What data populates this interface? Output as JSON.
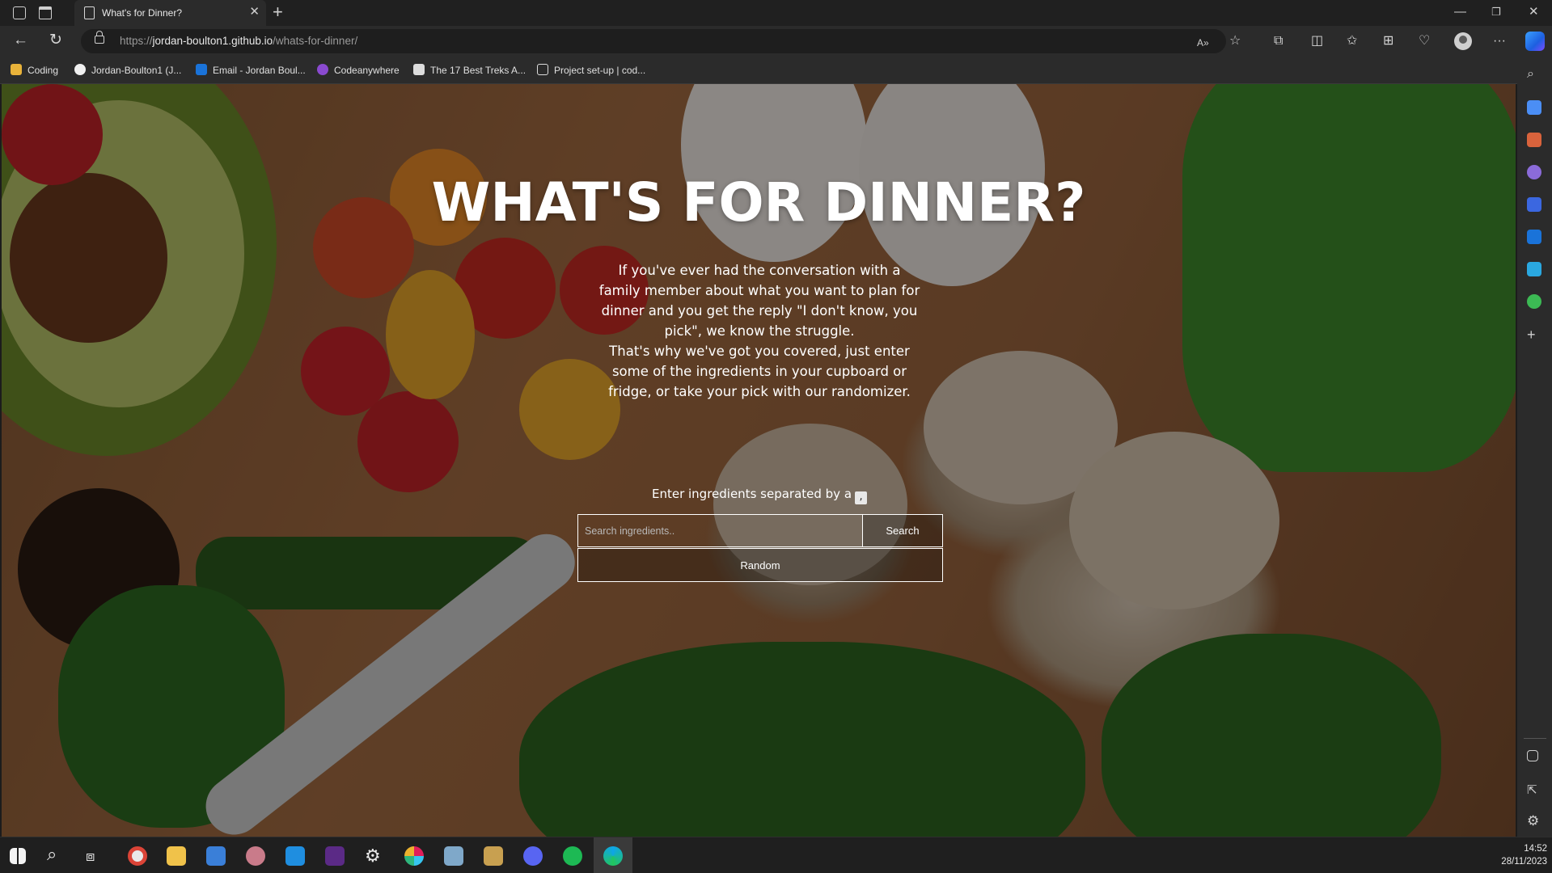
{
  "browser": {
    "tab_title": "What's for Dinner?",
    "url_prefix": "https://",
    "url_host": "jordan-boulton1.github.io",
    "url_path": "/whats-for-dinner/",
    "bookmarks": [
      {
        "label": "Coding",
        "icon": "folder-icon",
        "color": "#e8b23a"
      },
      {
        "label": "Jordan-Boulton1 (J...",
        "icon": "github-icon",
        "color": "#f0f0f0"
      },
      {
        "label": "Email - Jordan Boul...",
        "icon": "outlook-icon",
        "color": "#1a73d9"
      },
      {
        "label": "Codeanywhere",
        "icon": "codeanywhere-icon",
        "color": "#8a4ad0"
      },
      {
        "label": "The 17 Best Treks A...",
        "icon": "page-icon",
        "color": "#dcdcdc"
      },
      {
        "label": "Project set-up | cod...",
        "icon": "document-icon",
        "color": "#dcdcdc"
      }
    ]
  },
  "page": {
    "title": "WHAT'S FOR DINNER?",
    "intro_p1": "If you've ever had the conversation with a family member about what you want to plan for dinner and you get the reply \"I don't know, you pick\", we know the struggle.",
    "intro_p2": "That's why we've got you covered, just enter some of the ingredients in your cupboard or fridge, or take your pick with our randomizer.",
    "ingredients_label": "Enter ingredients separated by a",
    "separator": ",",
    "search_placeholder": "Search ingredients..",
    "search_button": "Search",
    "random_button": "Random"
  },
  "taskbar": {
    "time": "14:52",
    "date": "28/11/2023"
  },
  "colors": {
    "chrome_dark": "#202020",
    "chrome_mid": "#2b2b2b",
    "text_white": "#ffffff"
  }
}
